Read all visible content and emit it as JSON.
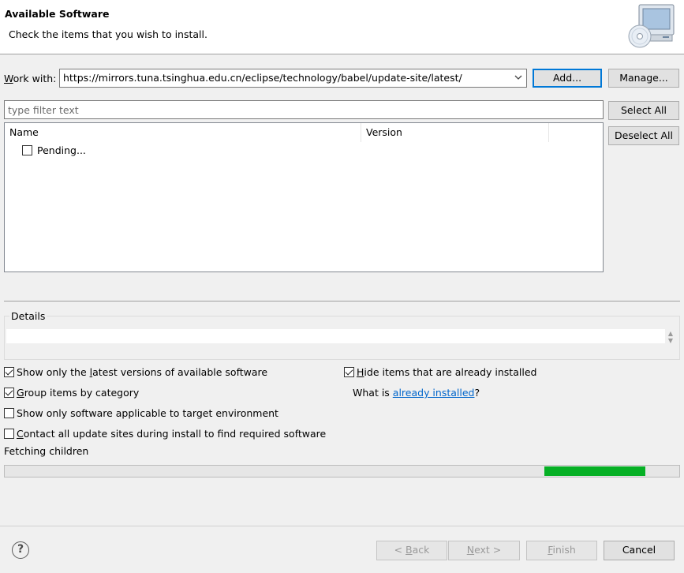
{
  "header": {
    "title": "Available Software",
    "subtitle": "Check the items that you wish to install."
  },
  "work_with": {
    "label": "Work with:",
    "value": "https://mirrors.tuna.tsinghua.edu.cn/eclipse/technology/babel/update-site/latest/",
    "add_label": "Add...",
    "manage_label": "Manage..."
  },
  "filter": {
    "placeholder": "type filter text"
  },
  "table": {
    "columns": [
      "Name",
      "Version"
    ],
    "rows": [
      {
        "name": "Pending...",
        "checked": false
      }
    ]
  },
  "side_buttons": {
    "select_all": "Select All",
    "deselect_all": "Deselect All"
  },
  "details": {
    "legend": "Details"
  },
  "options": {
    "latest_versions": {
      "label": "Show only the latest versions of available software",
      "checked": true
    },
    "group_by_category": {
      "label": "Group items by category",
      "checked": true
    },
    "target_env": {
      "label": "Show only software applicable to target environment",
      "checked": false
    },
    "contact_sites": {
      "label": "Contact all update sites during install to find required software",
      "checked": false
    },
    "hide_installed": {
      "label": "Hide items that are already installed",
      "checked": true
    },
    "what_is_prefix": "What is ",
    "what_is_link": "already installed",
    "what_is_suffix": "?"
  },
  "status": {
    "text": "Fetching children",
    "progress_start": 0.8,
    "progress_end": 0.95,
    "progress_color": "#06b025"
  },
  "footer": {
    "help_icon": "question-circle-icon",
    "back_label": "< Back",
    "next_label": "Next >",
    "finish_label": "Finish",
    "cancel_label": "Cancel"
  }
}
